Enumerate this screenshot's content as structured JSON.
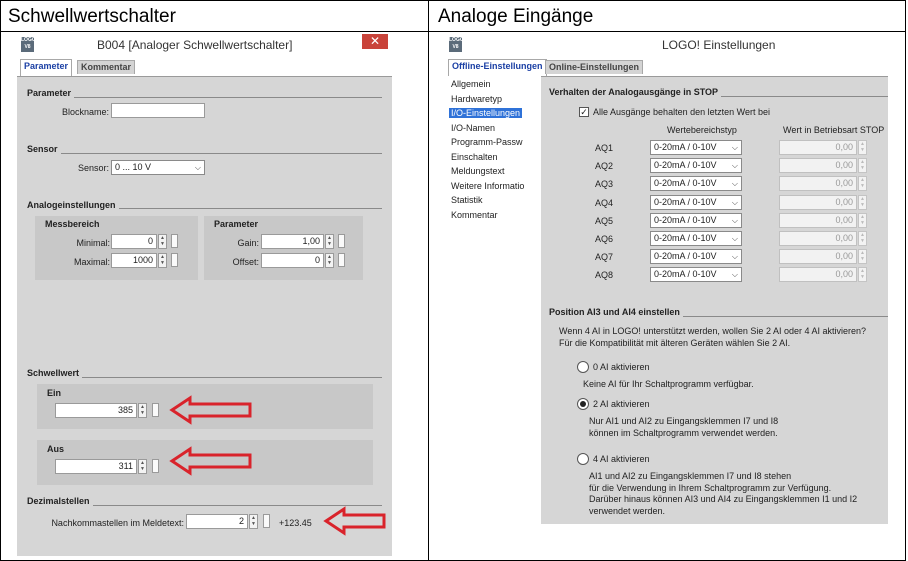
{
  "doc": {
    "left_title": "Schwellwertschalter",
    "right_title": "Analoge Eingänge"
  },
  "dialog1": {
    "logo_text": "LOGO V8",
    "title": "B004 [Analoger Schwellwertschalter]",
    "close_symbol": "✕",
    "tabs": [
      "Parameter",
      "Kommentar"
    ],
    "parameter_section": "Parameter",
    "blockname_label": "Blockname:",
    "blockname_value": "",
    "sensor_section": "Sensor",
    "sensor_label": "Sensor:",
    "sensor_value": "0 ... 10 V",
    "analog_section": "Analogeinstellungen",
    "messbereich_label": "Messbereich",
    "minimal_label": "Minimal:",
    "minimal_value": "0",
    "maximal_label": "Maximal:",
    "maximal_value": "1000",
    "param_group_label": "Parameter",
    "gain_label": "Gain:",
    "gain_value": "1,00",
    "offset_label": "Offset:",
    "offset_value": "0",
    "schwellwert_section": "Schwellwert",
    "ein_label": "Ein",
    "ein_value": "385",
    "aus_label": "Aus",
    "aus_value": "311",
    "dezimal_section": "Dezimalstellen",
    "nachkomma_label": "Nachkommastellen im Meldetext:",
    "nachkomma_value": "2",
    "preview_value": "+123.45",
    "arrow_color": "#d9232b"
  },
  "dialog2": {
    "logo_text": "LOGO V8",
    "title": "LOGO! Einstellungen",
    "tabs": [
      "Offline-Einstellungen",
      "Online-Einstellungen"
    ],
    "nav_items": [
      "Allgemein",
      "Hardwaretyp",
      "I/O-Einstellungen",
      "I/O-Namen",
      "Programm-Passw",
      "Einschalten",
      "Meldungstext",
      "Weitere Informatio",
      "Statistik",
      "Kommentar"
    ],
    "nav_selected_index": 2,
    "section1_title": "Verhalten der Analogausgänge in STOP",
    "keep_last_label": "Alle Ausgänge behalten den letzten Wert bei",
    "keep_last_checked": true,
    "col_range_header": "Wertebereichstyp",
    "col_stop_header": "Wert in Betriebsart STOP",
    "outputs": [
      {
        "name": "AQ1",
        "range": "0-20mA / 0-10V",
        "stop": "0,00"
      },
      {
        "name": "AQ2",
        "range": "0-20mA / 0-10V",
        "stop": "0,00"
      },
      {
        "name": "AQ3",
        "range": "0-20mA / 0-10V",
        "stop": "0,00"
      },
      {
        "name": "AQ4",
        "range": "0-20mA / 0-10V",
        "stop": "0,00"
      },
      {
        "name": "AQ5",
        "range": "0-20mA / 0-10V",
        "stop": "0,00"
      },
      {
        "name": "AQ6",
        "range": "0-20mA / 0-10V",
        "stop": "0,00"
      },
      {
        "name": "AQ7",
        "range": "0-20mA / 0-10V",
        "stop": "0,00"
      },
      {
        "name": "AQ8",
        "range": "0-20mA / 0-10V",
        "stop": "0,00"
      }
    ],
    "section2_title": "Position AI3 und AI4 einstellen",
    "intro_line1": "Wenn 4 AI in LOGO! unterstützt werden, wollen Sie 2 AI oder 4 AI aktivieren?",
    "intro_line2": "Für die Kompatibilität mit älteren Geräten wählen Sie 2 AI.",
    "options": [
      {
        "label": "0 AI aktivieren",
        "selected": false,
        "desc": [
          "Keine AI für Ihr Schaltprogramm verfügbar."
        ]
      },
      {
        "label": "2 AI aktivieren",
        "selected": true,
        "desc": [
          "Nur AI1 und AI2 zu Eingangsklemmen I7 und I8",
          "können im Schaltprogramm verwendet werden."
        ]
      },
      {
        "label": "4 AI aktivieren",
        "selected": false,
        "desc": [
          "AI1 und AI2 zu Eingangsklemmen I7 und I8 stehen",
          "für die Verwendung in Ihrem Schaltprogramm zur Verfügung.",
          "Darüber hinaus können AI3 und AI4 zu Eingangsklemmen I1 und I2",
          "verwendet werden."
        ]
      }
    ]
  }
}
